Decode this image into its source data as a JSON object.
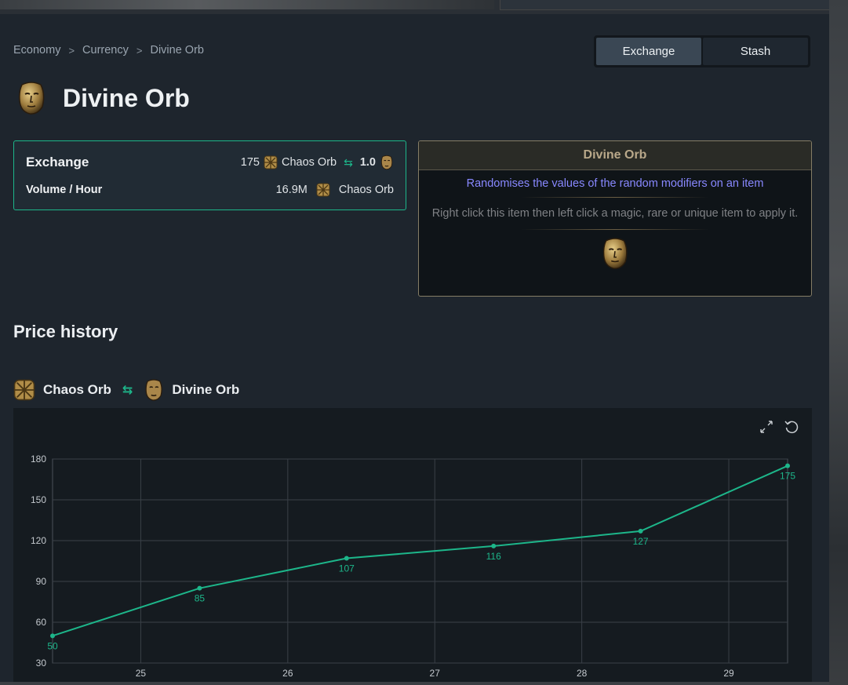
{
  "breadcrumb": {
    "items": [
      "Economy",
      "Currency",
      "Divine Orb"
    ],
    "separator": ">"
  },
  "tabs": {
    "exchange": "Exchange",
    "stash": "Stash",
    "active": "Exchange"
  },
  "item": {
    "name": "Divine Orb",
    "icon": "divine-orb-icon"
  },
  "exchange_card": {
    "exchange_label": "Exchange",
    "exchange_amount": "175",
    "exchange_currency": "Chaos Orb",
    "exchange_ratio": "1.0",
    "volume_label": "Volume / Hour",
    "volume_amount": "16.9M",
    "volume_currency": "Chaos Orb"
  },
  "tooltip": {
    "title": "Divine Orb",
    "modifier": "Randomises the values of the random modifiers on an item",
    "help": "Right click this item then left click a magic, rare or unique item to apply it."
  },
  "price_history": {
    "heading": "Price history",
    "from": "Chaos Orb",
    "to": "Divine Orb"
  },
  "colors": {
    "accent": "#1db68a",
    "tooltip_border": "#857d66",
    "magic_text": "#8888ff"
  },
  "chart_data": {
    "type": "line",
    "x": [
      24.4,
      25.4,
      26.4,
      27.4,
      28.4,
      29.4
    ],
    "values": [
      50,
      85,
      107,
      116,
      127,
      175
    ],
    "data_labels": [
      "50",
      "85",
      "107",
      "116",
      "127",
      "175"
    ],
    "xticks": [
      25,
      26,
      27,
      28,
      29
    ],
    "xtick_labels": [
      "25",
      "26",
      "27",
      "28",
      "29"
    ],
    "yticks": [
      30,
      60,
      90,
      120,
      150,
      180
    ],
    "ytick_labels": [
      "30",
      "60",
      "90",
      "120",
      "150",
      "180"
    ],
    "ylim": [
      30,
      180
    ],
    "xlim": [
      24.4,
      29.4
    ],
    "grid": true,
    "line_color": "#1db68a"
  }
}
